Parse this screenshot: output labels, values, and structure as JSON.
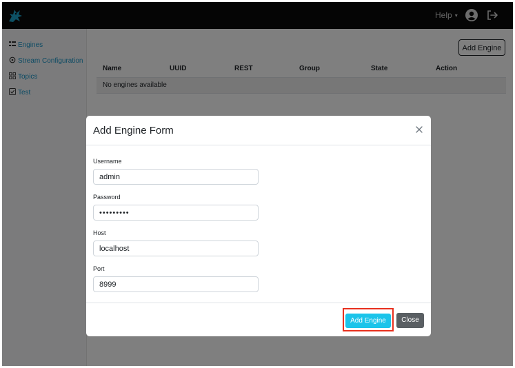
{
  "header": {
    "help_label": "Help",
    "caret": "▾"
  },
  "sidebar": {
    "items": [
      {
        "label": "Engines",
        "icon": "list-icon"
      },
      {
        "label": "Stream Configuration",
        "icon": "gear-icon"
      },
      {
        "label": "Topics",
        "icon": "grid-icon"
      },
      {
        "label": "Test",
        "icon": "check-square-icon"
      }
    ]
  },
  "main": {
    "add_button": "Add Engine",
    "table": {
      "columns": [
        "Name",
        "UUID",
        "REST",
        "Group",
        "State",
        "Action"
      ],
      "empty_message": "No engines available"
    }
  },
  "modal": {
    "title": "Add Engine Form",
    "fields": {
      "username": {
        "label": "Username",
        "value": "admin"
      },
      "password": {
        "label": "Password",
        "value": "•••••••••"
      },
      "host": {
        "label": "Host",
        "value": "localhost"
      },
      "port": {
        "label": "Port",
        "value": "8999"
      }
    },
    "submit_label": "Add Engine",
    "close_label": "Close",
    "close_symbol": "×"
  },
  "colors": {
    "accent": "#1a96c8",
    "primary_button": "#1bc4ea",
    "secondary_button": "#5a5f63",
    "highlight": "#e8301e"
  }
}
